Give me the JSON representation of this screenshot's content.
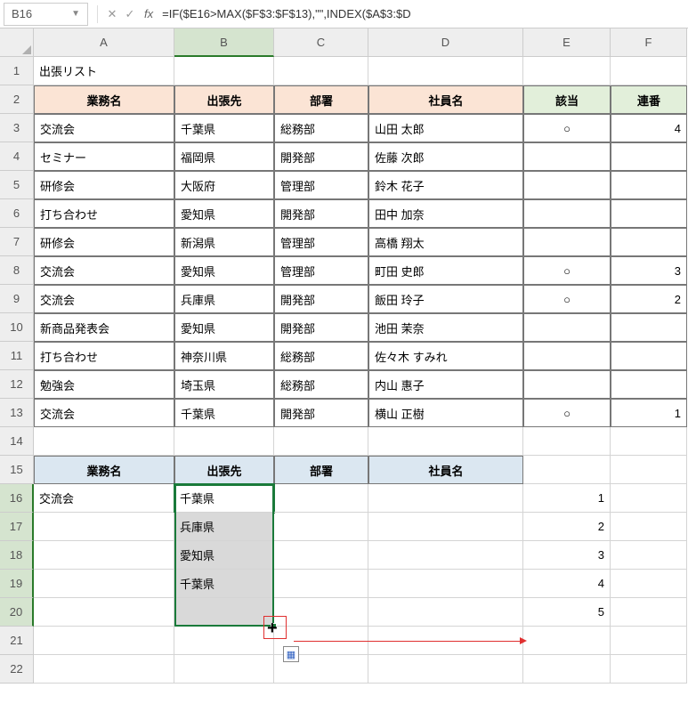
{
  "nameBox": "B16",
  "formula": "=IF($E16>MAX($F$3:$F$13),\"\",INDEX($A$3:$D",
  "columns": [
    "A",
    "B",
    "C",
    "D",
    "E",
    "F"
  ],
  "rowCount": 22,
  "title": "出張リスト",
  "headers1": {
    "A": "業務名",
    "B": "出張先",
    "C": "部署",
    "D": "社員名",
    "E": "該当",
    "F": "連番"
  },
  "rows": [
    {
      "A": "交流会",
      "B": "千葉県",
      "C": "総務部",
      "D": "山田 太郎",
      "E": "○",
      "F": "4"
    },
    {
      "A": "セミナー",
      "B": "福岡県",
      "C": "開発部",
      "D": "佐藤 次郎",
      "E": "",
      "F": ""
    },
    {
      "A": "研修会",
      "B": "大阪府",
      "C": "管理部",
      "D": "鈴木 花子",
      "E": "",
      "F": ""
    },
    {
      "A": "打ち合わせ",
      "B": "愛知県",
      "C": "開発部",
      "D": "田中 加奈",
      "E": "",
      "F": ""
    },
    {
      "A": "研修会",
      "B": "新潟県",
      "C": "管理部",
      "D": "高橋 翔太",
      "E": "",
      "F": ""
    },
    {
      "A": "交流会",
      "B": "愛知県",
      "C": "管理部",
      "D": "町田 史郎",
      "E": "○",
      "F": "3"
    },
    {
      "A": "交流会",
      "B": "兵庫県",
      "C": "開発部",
      "D": "飯田 玲子",
      "E": "○",
      "F": "2"
    },
    {
      "A": "新商品発表会",
      "B": "愛知県",
      "C": "開発部",
      "D": "池田 茉奈",
      "E": "",
      "F": ""
    },
    {
      "A": "打ち合わせ",
      "B": "神奈川県",
      "C": "総務部",
      "D": "佐々木 すみれ",
      "E": "",
      "F": ""
    },
    {
      "A": "勉強会",
      "B": "埼玉県",
      "C": "総務部",
      "D": "内山 惠子",
      "E": "",
      "F": ""
    },
    {
      "A": "交流会",
      "B": "千葉県",
      "C": "開発部",
      "D": "横山 正樹",
      "E": "○",
      "F": "1"
    }
  ],
  "headers2": {
    "A": "業務名",
    "B": "出張先",
    "C": "部署",
    "D": "社員名"
  },
  "result": {
    "A16": "交流会",
    "B16": "千葉県",
    "B17": "兵庫県",
    "B18": "愛知県",
    "B19": "千葉県",
    "E16": "1",
    "E17": "2",
    "E18": "3",
    "E19": "4",
    "E20": "5"
  }
}
